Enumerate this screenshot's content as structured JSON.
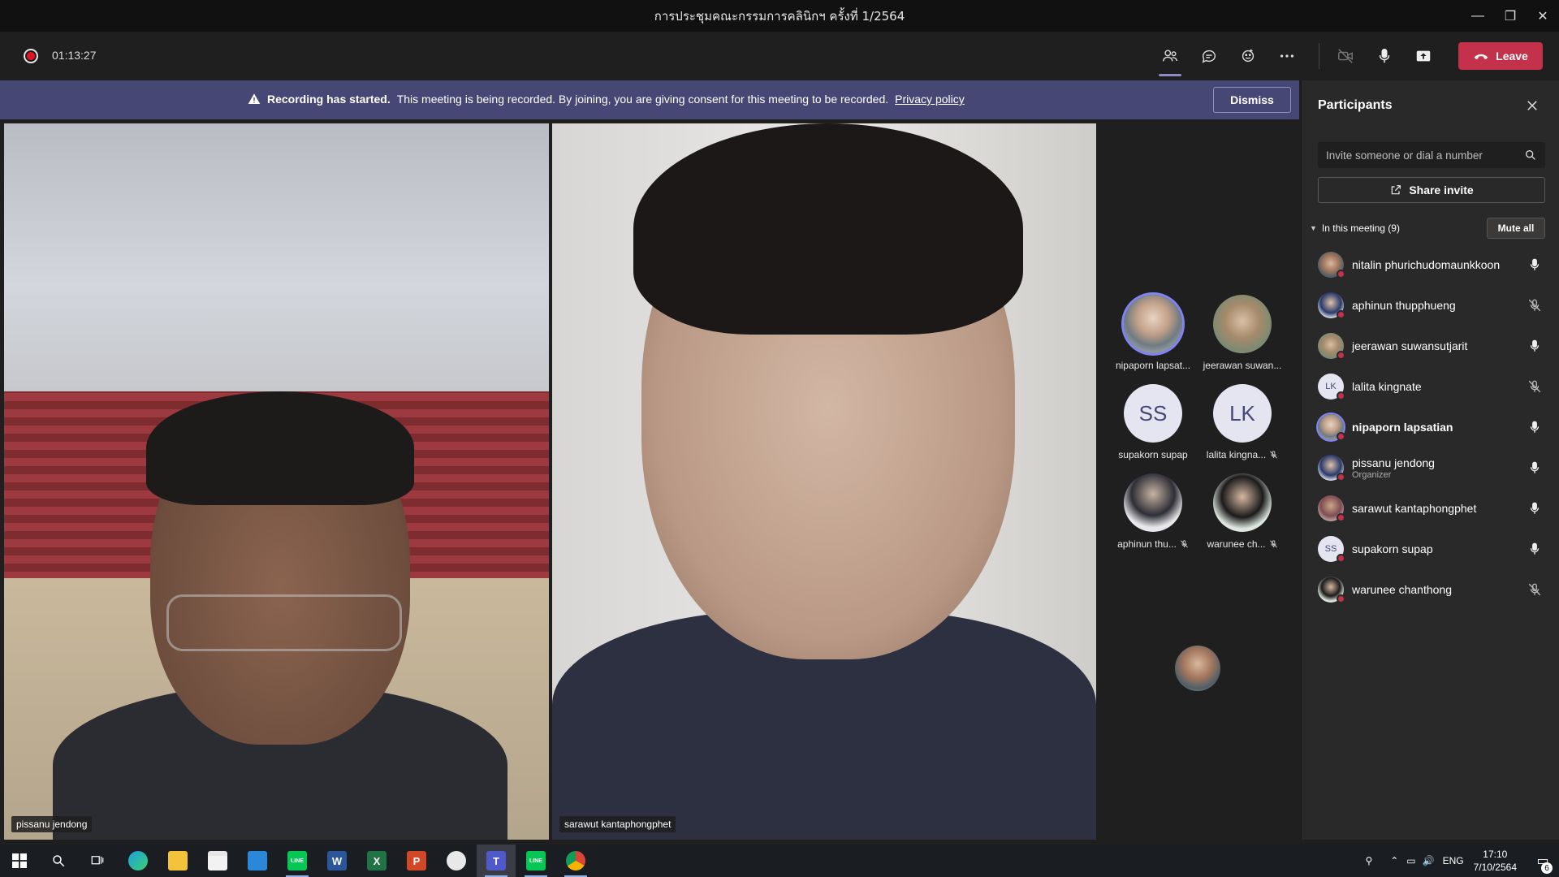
{
  "window": {
    "title": "การประชุมคณะกรรมการคลินิกฯ ครั้งที่ 1/2564",
    "min_glyph": "—",
    "max_glyph": "❐",
    "close_glyph": "✕"
  },
  "toolbar": {
    "timer": "01:13:27",
    "icons": [
      "participants-icon",
      "chat-icon",
      "reactions-icon",
      "more-options-icon",
      "camera-off-icon",
      "microphone-icon",
      "share-tray-icon"
    ],
    "leave_label": "Leave",
    "leave_color": "#c4314b"
  },
  "banner": {
    "bold": "Recording has started.",
    "text": "This meeting is being recorded. By joining, you are giving consent for this meeting to be recorded.",
    "link": "Privacy policy",
    "dismiss": "Dismiss",
    "background": "#464775"
  },
  "videos": [
    {
      "name": "pissanu jendong"
    },
    {
      "name": "sarawut kantaphongphet"
    }
  ],
  "gallery": [
    {
      "name": "nipaporn lapsat...",
      "initials": "",
      "muted": false,
      "speaking": true
    },
    {
      "name": "jeerawan suwan...",
      "initials": "",
      "muted": false,
      "speaking": false
    },
    {
      "name": "supakorn supap",
      "initials": "SS",
      "muted": false,
      "speaking": false
    },
    {
      "name": "lalita kingna...",
      "initials": "LK",
      "muted": true,
      "speaking": false
    },
    {
      "name": "aphinun thu...",
      "initials": "",
      "muted": true,
      "speaking": false
    },
    {
      "name": "warunee ch...",
      "initials": "",
      "muted": true,
      "speaking": false
    }
  ],
  "panel": {
    "title": "Participants",
    "search_placeholder": "Invite someone or dial a number",
    "share_invite": "Share invite",
    "section": "In this meeting (9)",
    "mute_all": "Mute all",
    "participants": [
      {
        "name": "nitalin phurichudomaunkkoon",
        "role": "",
        "initials": "",
        "muted": false
      },
      {
        "name": "aphinun thupphueng",
        "role": "",
        "initials": "",
        "muted": true
      },
      {
        "name": "jeerawan suwansutjarit",
        "role": "",
        "initials": "",
        "muted": false
      },
      {
        "name": "lalita kingnate",
        "role": "",
        "initials": "LK",
        "muted": true
      },
      {
        "name": "nipaporn lapsatian",
        "role": "",
        "initials": "",
        "muted": false
      },
      {
        "name": "pissanu jendong",
        "role": "Organizer",
        "initials": "",
        "muted": false
      },
      {
        "name": "sarawut kantaphongphet",
        "role": "",
        "initials": "",
        "muted": false
      },
      {
        "name": "supakorn supap",
        "role": "",
        "initials": "SS",
        "muted": false
      },
      {
        "name": "warunee chanthong",
        "role": "",
        "initials": "",
        "muted": true
      }
    ]
  },
  "taskbar": {
    "apps": [
      "start-icon",
      "search-icon",
      "task-view-icon",
      "edge-icon",
      "file-explorer-icon",
      "store-icon",
      "mail-icon",
      "line-icon",
      "word-icon",
      "excel-icon",
      "powerpoint-icon",
      "snip-icon",
      "teams-icon",
      "line-icon-2",
      "chrome-icon"
    ],
    "app_letters": {
      "word": "W",
      "excel": "X",
      "powerpoint": "P",
      "teams": "T",
      "line": "LINE"
    },
    "language": "ENG",
    "time": "17:10",
    "date": "7/10/2564",
    "notifications": "6"
  }
}
